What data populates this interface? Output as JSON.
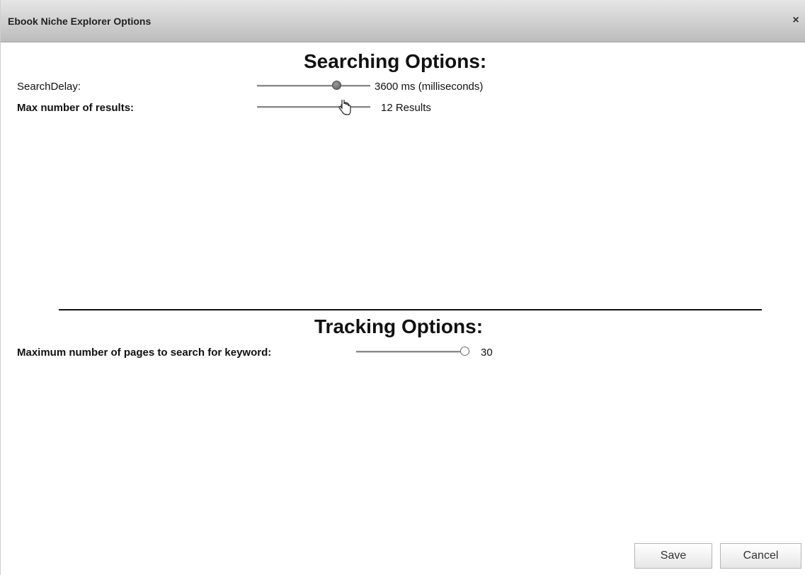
{
  "window": {
    "title": "Ebook Niche Explorer Options",
    "close_symbol": "×"
  },
  "searching": {
    "heading": "Searching Options:",
    "search_delay": {
      "label": "SearchDelay:",
      "value_text": "3600 ms (milliseconds)",
      "slider_fraction": 0.72
    },
    "max_results": {
      "label": "Max number of results:",
      "value_text": "12 Results",
      "slider_fraction": 0.8
    }
  },
  "tracking": {
    "heading": "Tracking Options:",
    "max_pages": {
      "label": "Maximum number of pages to search for keyword:",
      "value_text": "30",
      "slider_fraction": 1.0
    }
  },
  "buttons": {
    "save": "Save",
    "cancel": "Cancel"
  },
  "icons": {
    "close": "close-icon",
    "cursor": "hand-pointer-icon"
  },
  "colors": {
    "titlebar_top": "#e6e6e6",
    "titlebar_bottom": "#bcbcbc",
    "slider_thumb": "#6b6b6b"
  }
}
